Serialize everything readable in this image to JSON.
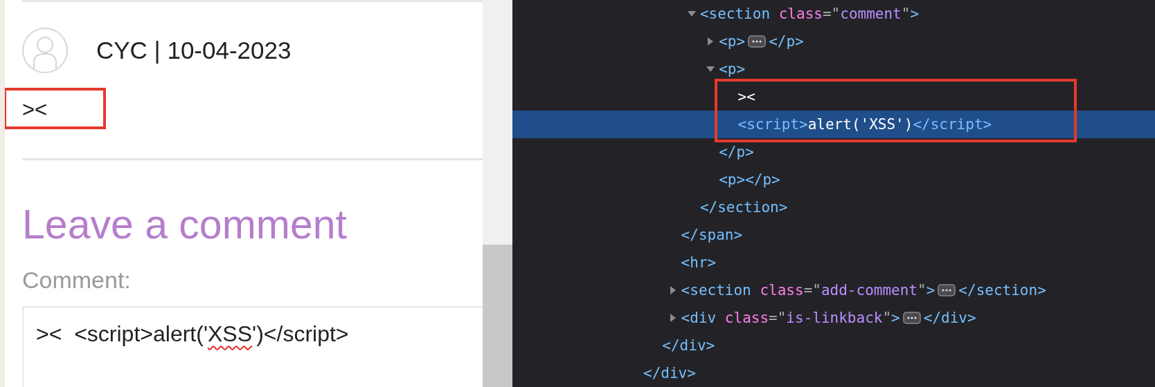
{
  "page": {
    "comment": {
      "author_line": "CYC | 10-04-2023",
      "body": "><",
      "highlighted": true
    },
    "form": {
      "heading": "Leave a comment",
      "label": "Comment:",
      "value": [
        {
          "text": "><  <script>alert('",
          "misspelled": false
        },
        {
          "text": "XSS",
          "misspelled": true
        },
        {
          "text": "')</script>",
          "misspelled": false
        }
      ]
    }
  },
  "devtools": {
    "tree": [
      {
        "close": "</div>",
        "selected": false,
        "children": [
          {
            "close": "</div>",
            "selected": false,
            "children": [
              {
                "close": "</span>",
                "selected": false,
                "children": [
                  {
                    "open": "<section class=\"comment\">",
                    "expanded": true,
                    "close": "</section>",
                    "selected": false,
                    "children": [
                      {
                        "open": "<p>",
                        "expanded": false,
                        "close": "</p>",
                        "selected": false
                      },
                      {
                        "open": "<p>",
                        "expanded": true,
                        "close": "</p>",
                        "selected": false,
                        "highlighted": true,
                        "children": [
                          {
                            "text": "><",
                            "selected": false
                          },
                          {
                            "open": "<script>",
                            "text": "alert('XSS')",
                            "close": "</script>",
                            "selected": true
                          }
                        ]
                      },
                      {
                        "open": "<p>",
                        "close": "</p>",
                        "selected": false
                      }
                    ]
                  }
                ]
              },
              {
                "open": "<hr>",
                "selected": false
              },
              {
                "open": "<section class=\"add-comment\">",
                "expanded": false,
                "close": "</section>",
                "selected": false
              },
              {
                "open": "<div class=\"is-linkback\">",
                "expanded": false,
                "close": "</div>",
                "selected": false
              }
            ]
          }
        ]
      }
    ]
  }
}
